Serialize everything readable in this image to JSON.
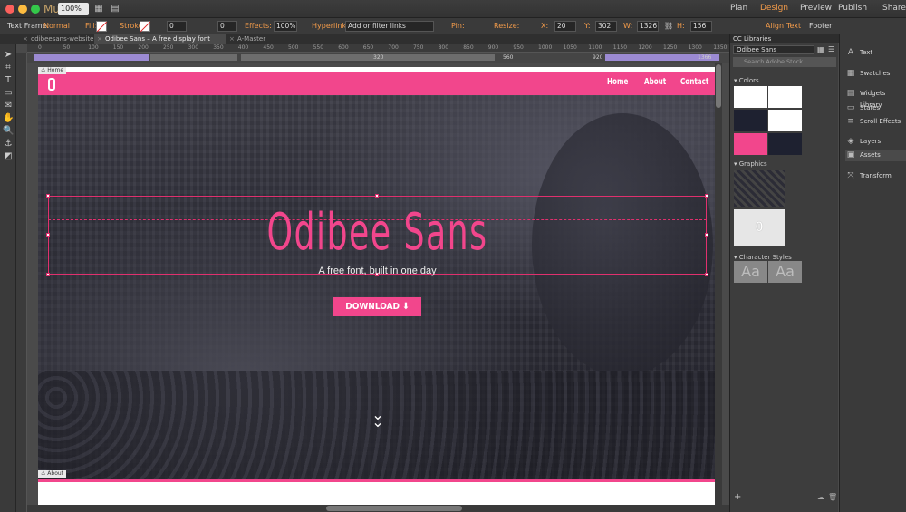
{
  "app": {
    "logo": "Mu",
    "zoom": "100%"
  },
  "modes": {
    "plan": "Plan",
    "design": "Design",
    "preview": "Preview",
    "publish": "Publish",
    "share": "Share"
  },
  "controlbar": {
    "text_frame_label": "Text Frame:",
    "text_frame_value": "Normal",
    "fill": "Fill:",
    "stroke": "Stroke:",
    "stroke_value": "0",
    "corner_value": "0",
    "effects": "Effects:",
    "effects_value": "100%",
    "hyperlinks": "Hyperlinks:",
    "hyperlinks_placeholder": "Add or filter links",
    "pin": "Pin:",
    "resize": "Resize:",
    "x_label": "X:",
    "x_value": "20",
    "y_label": "Y:",
    "y_value": "302",
    "w_label": "W:",
    "w_value": "1326",
    "h_label": "H:",
    "h_value": "156",
    "align": "Align",
    "text": "Text",
    "footer": "Footer"
  },
  "tabs": [
    {
      "label": "odibeesans-website"
    },
    {
      "label": "Odibee Sans – A free display font made a day!"
    },
    {
      "label": "A-Master"
    }
  ],
  "ruler_ticks": [
    "0",
    "50",
    "100",
    "150",
    "200",
    "250",
    "300",
    "350",
    "400",
    "450",
    "500",
    "550",
    "600",
    "650",
    "700",
    "750",
    "800",
    "850",
    "900",
    "950",
    "1000",
    "1050",
    "1100",
    "1150",
    "1200",
    "1250",
    "1300",
    "1350"
  ],
  "breakpoints": {
    "bp1": "320",
    "bp2": "560",
    "bp3": "920",
    "bp4": "1366"
  },
  "page": {
    "anchor_home": "Home",
    "anchor_about": "About",
    "nav": [
      "Home",
      "About",
      "Contact"
    ],
    "hero_title": "Odibee Sans",
    "hero_subtitle": "A free font, built in one day",
    "download_label": "DOWNLOAD"
  },
  "libraries": {
    "title": "CC Libraries",
    "library_name": "Odibee Sans",
    "search_placeholder": "Search Adobe Stock",
    "colors_label": "Colors",
    "graphics_label": "Graphics",
    "char_styles_label": "Character Styles",
    "graphic_logo_text": "0",
    "char_style_sample": "Aa",
    "swatch_colors": [
      "#ffffff",
      "#ffffff",
      "#1e2130",
      "#ffffff",
      "#f2468c",
      "#1e2130"
    ]
  },
  "dock": [
    "Text",
    "Swatches",
    "Widgets Library",
    "States",
    "Scroll Effects",
    "Layers",
    "Assets",
    "Transform"
  ],
  "colors": {
    "accent_pink": "#f2468c",
    "ui_orange": "#f29b4a"
  }
}
